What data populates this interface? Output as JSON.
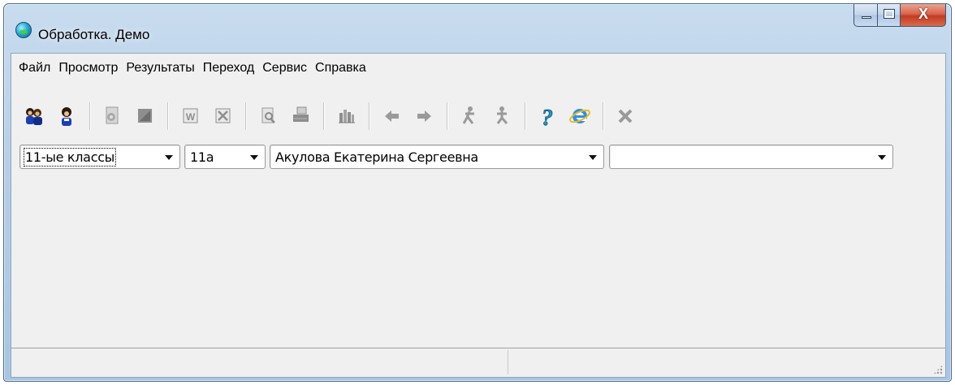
{
  "window": {
    "title": "Обработка. Демо",
    "icon": "globe-icon",
    "accent": "#b7cfe8",
    "caption_buttons": {
      "minimize_icon": "minimize-icon",
      "maximize_icon": "maximize-icon",
      "close_icon": "close-icon",
      "close_glyph": "X"
    }
  },
  "menubar": {
    "items": [
      "Файл",
      "Просмотр",
      "Результаты",
      "Переход",
      "Сервис",
      "Справка"
    ]
  },
  "toolbar": {
    "buttons": [
      {
        "icon": "group-users-icon",
        "enabled": true
      },
      {
        "icon": "single-user-icon",
        "enabled": true
      },
      {
        "icon": "document-gear-icon",
        "enabled": false
      },
      {
        "icon": "edit-box-icon",
        "enabled": false
      },
      {
        "icon": "word-export-icon",
        "enabled": false
      },
      {
        "icon": "excel-export-icon",
        "enabled": false
      },
      {
        "icon": "print-preview-icon",
        "enabled": false
      },
      {
        "icon": "printer-icon",
        "enabled": false
      },
      {
        "icon": "chart-icon",
        "enabled": false
      },
      {
        "icon": "arrow-left-icon",
        "enabled": false
      },
      {
        "icon": "arrow-right-icon",
        "enabled": false
      },
      {
        "icon": "person-walk-icon",
        "enabled": false
      },
      {
        "icon": "person-walk-alt-icon",
        "enabled": false
      },
      {
        "icon": "help-icon",
        "enabled": true
      },
      {
        "icon": "internet-explorer-icon",
        "enabled": true
      },
      {
        "icon": "close-icon",
        "enabled": false
      }
    ],
    "help_glyph": "?"
  },
  "filters": {
    "class_group": "11-ые классы",
    "class": "11а",
    "student": "Акулова Екатерина Сергеевна",
    "extra": ""
  },
  "statusbar": {
    "left": "",
    "right": ""
  }
}
